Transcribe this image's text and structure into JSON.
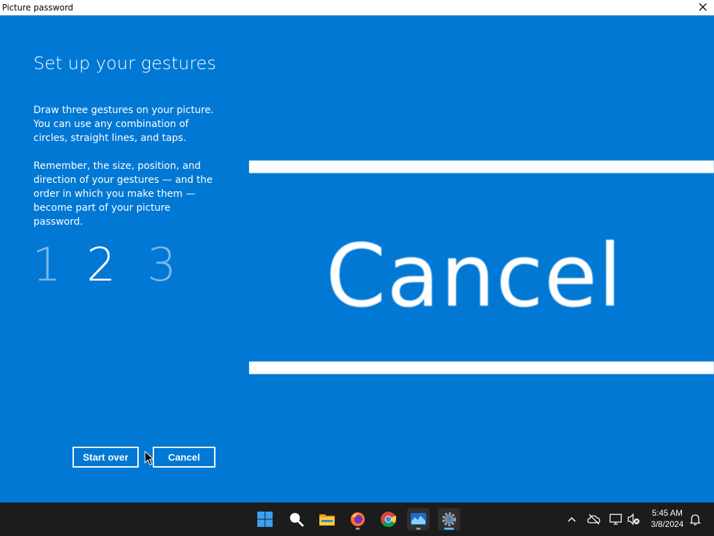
{
  "window": {
    "title": "Picture password"
  },
  "main": {
    "heading": "Set up your gestures",
    "paragraph_1": "Draw three gestures on your picture. You can use any combination of circles, straight lines, and taps.",
    "paragraph_2": "Remember, the size, position, and direction of your gestures — and the order in which you make them — become part of your picture password.",
    "steps": [
      "1",
      "2",
      "3"
    ],
    "current_step": 2,
    "start_over_label": "Start over",
    "cancel_label": "Cancel"
  },
  "picture": {
    "text": "Cancel"
  },
  "taskbar": {
    "apps": [
      {
        "icon": "windows-start-icon"
      },
      {
        "icon": "search-icon"
      },
      {
        "icon": "file-explorer-icon"
      },
      {
        "icon": "firefox-icon",
        "running": true
      },
      {
        "icon": "chrome-icon"
      },
      {
        "icon": "task-manager-icon",
        "running": true
      },
      {
        "icon": "settings-icon",
        "running": true,
        "active": true
      }
    ],
    "tray": {
      "icons": [
        "chevron-up-icon",
        "onedrive-offline-icon",
        "network-icon",
        "volume-muted-icon",
        "notification-bell-icon"
      ]
    },
    "clock": {
      "time": "5:45 AM",
      "date": "3/8/2024"
    }
  },
  "colors": {
    "background": "#0078d4",
    "inactive_step": "#79b7ea",
    "taskbar": "#1c1c1c"
  }
}
